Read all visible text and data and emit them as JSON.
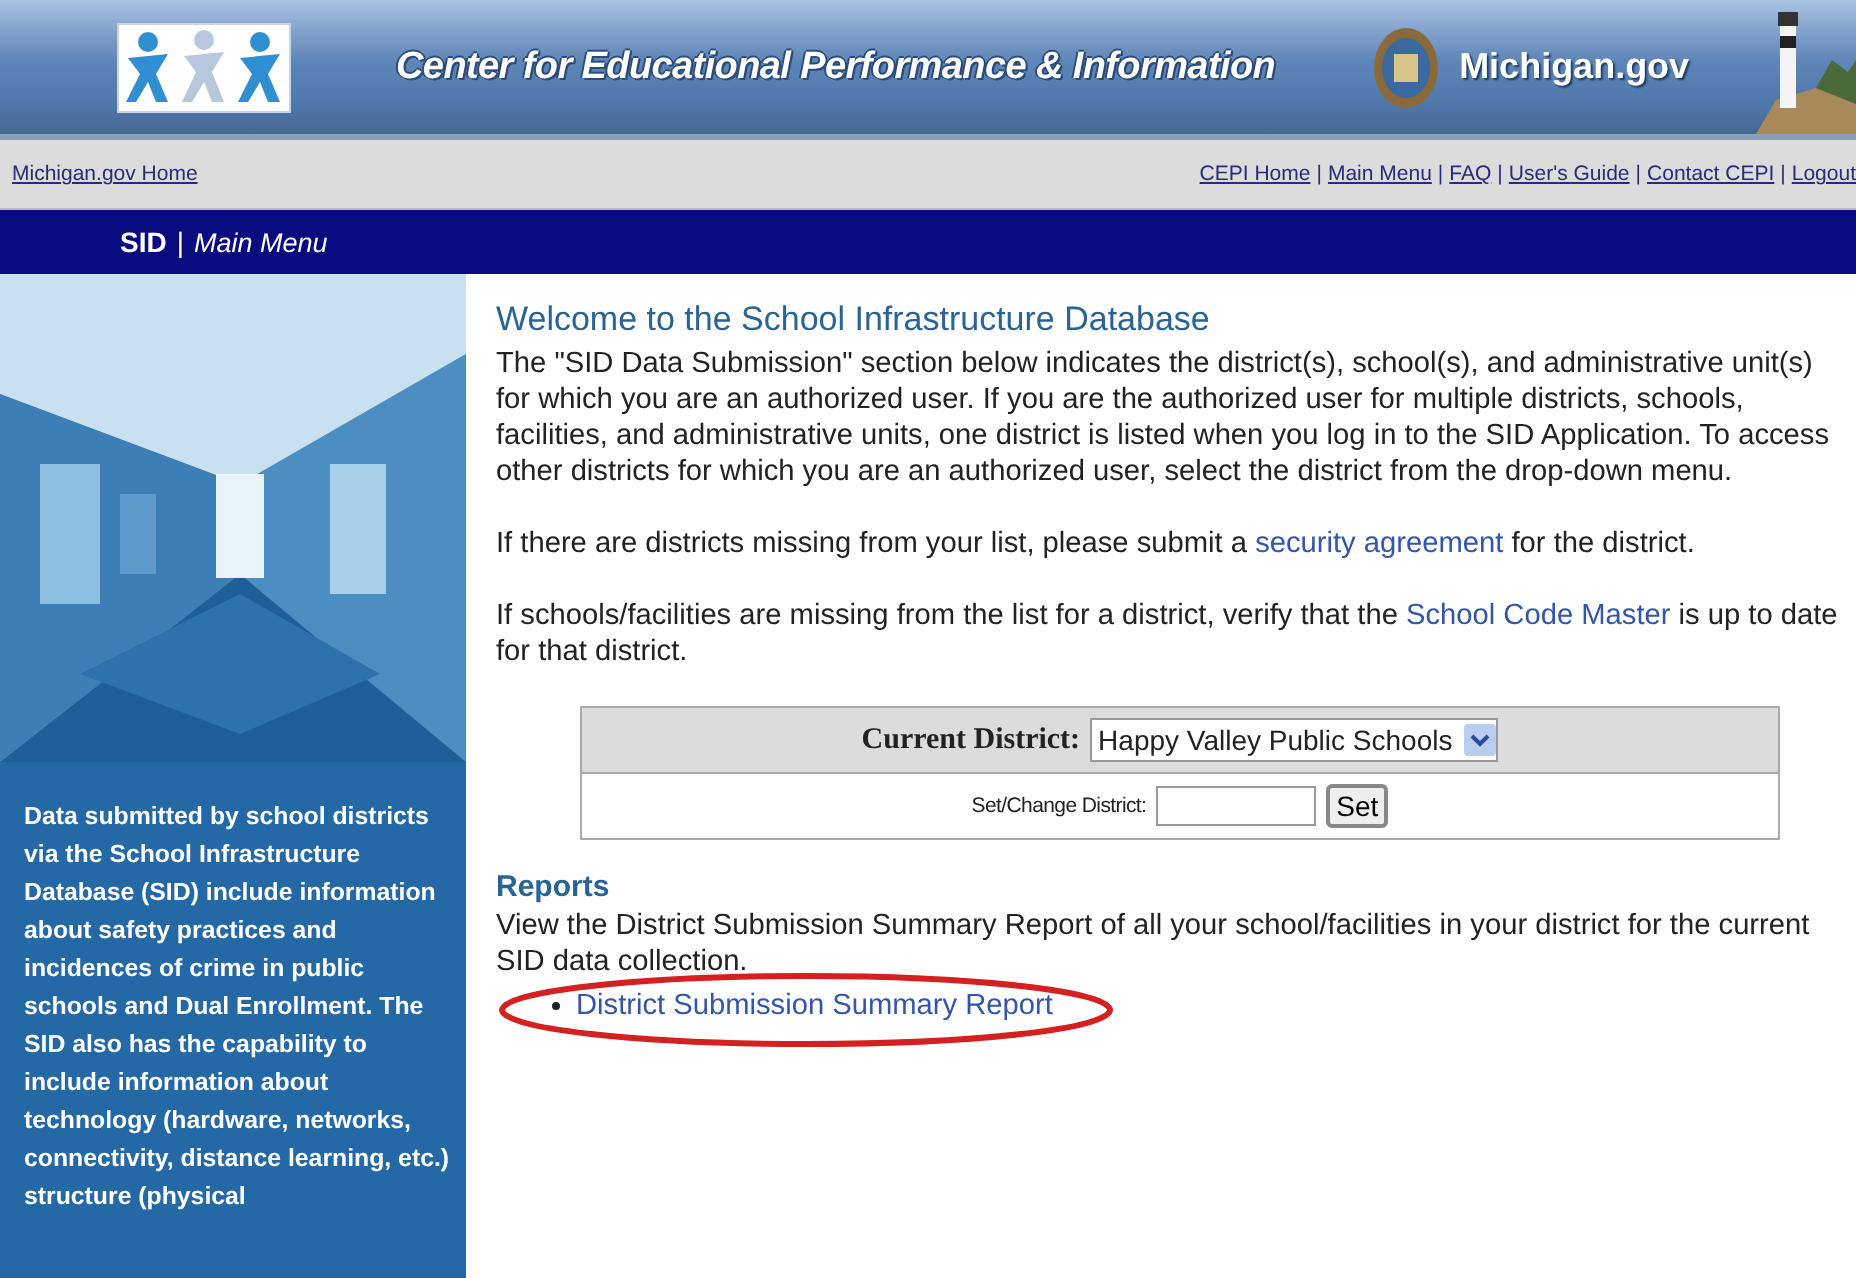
{
  "banner": {
    "title": "Center for Educational Performance & Information",
    "brand": "Michigan.gov"
  },
  "top_links": {
    "home": "Michigan.gov Home",
    "separator": "|",
    "links": [
      "CEPI Home",
      "Main Menu",
      "FAQ",
      "User's Guide",
      "Contact CEPI",
      "Logout"
    ]
  },
  "title_bar": {
    "app": "SID",
    "separator": "|",
    "page": "Main Menu"
  },
  "sidebar": {
    "text": "Data submitted by school districts via the School Infrastructure Database (SID) include information about safety practices and incidences of crime in public schools and Dual Enrollment. The SID also has the capability to include information about technology (hardware, networks, connectivity, distance learning, etc.) structure (physical"
  },
  "main": {
    "heading": "Welcome to the School Infrastructure Database",
    "paragraphs": [
      {
        "segments": [
          {
            "text": "The \"SID Data Submission\" section below indicates the district(s), school(s), and administrative unit(s) for which you are an authorized user. If you are the authorized user for multiple districts, schools, facilities, and administrative units, one district is listed when you log in to the SID Application. To access other districts for which you are an authorized user, select the district from the drop-down menu.",
            "kind": "text"
          }
        ]
      },
      {
        "segments": [
          {
            "text": "If there are districts missing from your list, please submit a ",
            "kind": "text"
          },
          {
            "text": "security agreement",
            "kind": "link"
          },
          {
            "text": " for the district.",
            "kind": "text"
          }
        ]
      },
      {
        "segments": [
          {
            "text": "If schools/facilities are missing from the list for a district, verify that the ",
            "kind": "text"
          },
          {
            "text": "School Code Master",
            "kind": "link"
          },
          {
            "text": " is up to date for that district.",
            "kind": "text"
          }
        ]
      }
    ],
    "district_form": {
      "current_label": "Current District:",
      "current_value": "Happy Valley Public Schools",
      "change_label": "Set/Change District:",
      "button": "Set"
    },
    "reports": {
      "heading": "Reports",
      "text": "View the District Submission Summary Report of all your school/facilities in your district for the current SID data collection.",
      "links": [
        {
          "label": "District Submission Summary Report",
          "highlighted": true
        }
      ]
    }
  }
}
